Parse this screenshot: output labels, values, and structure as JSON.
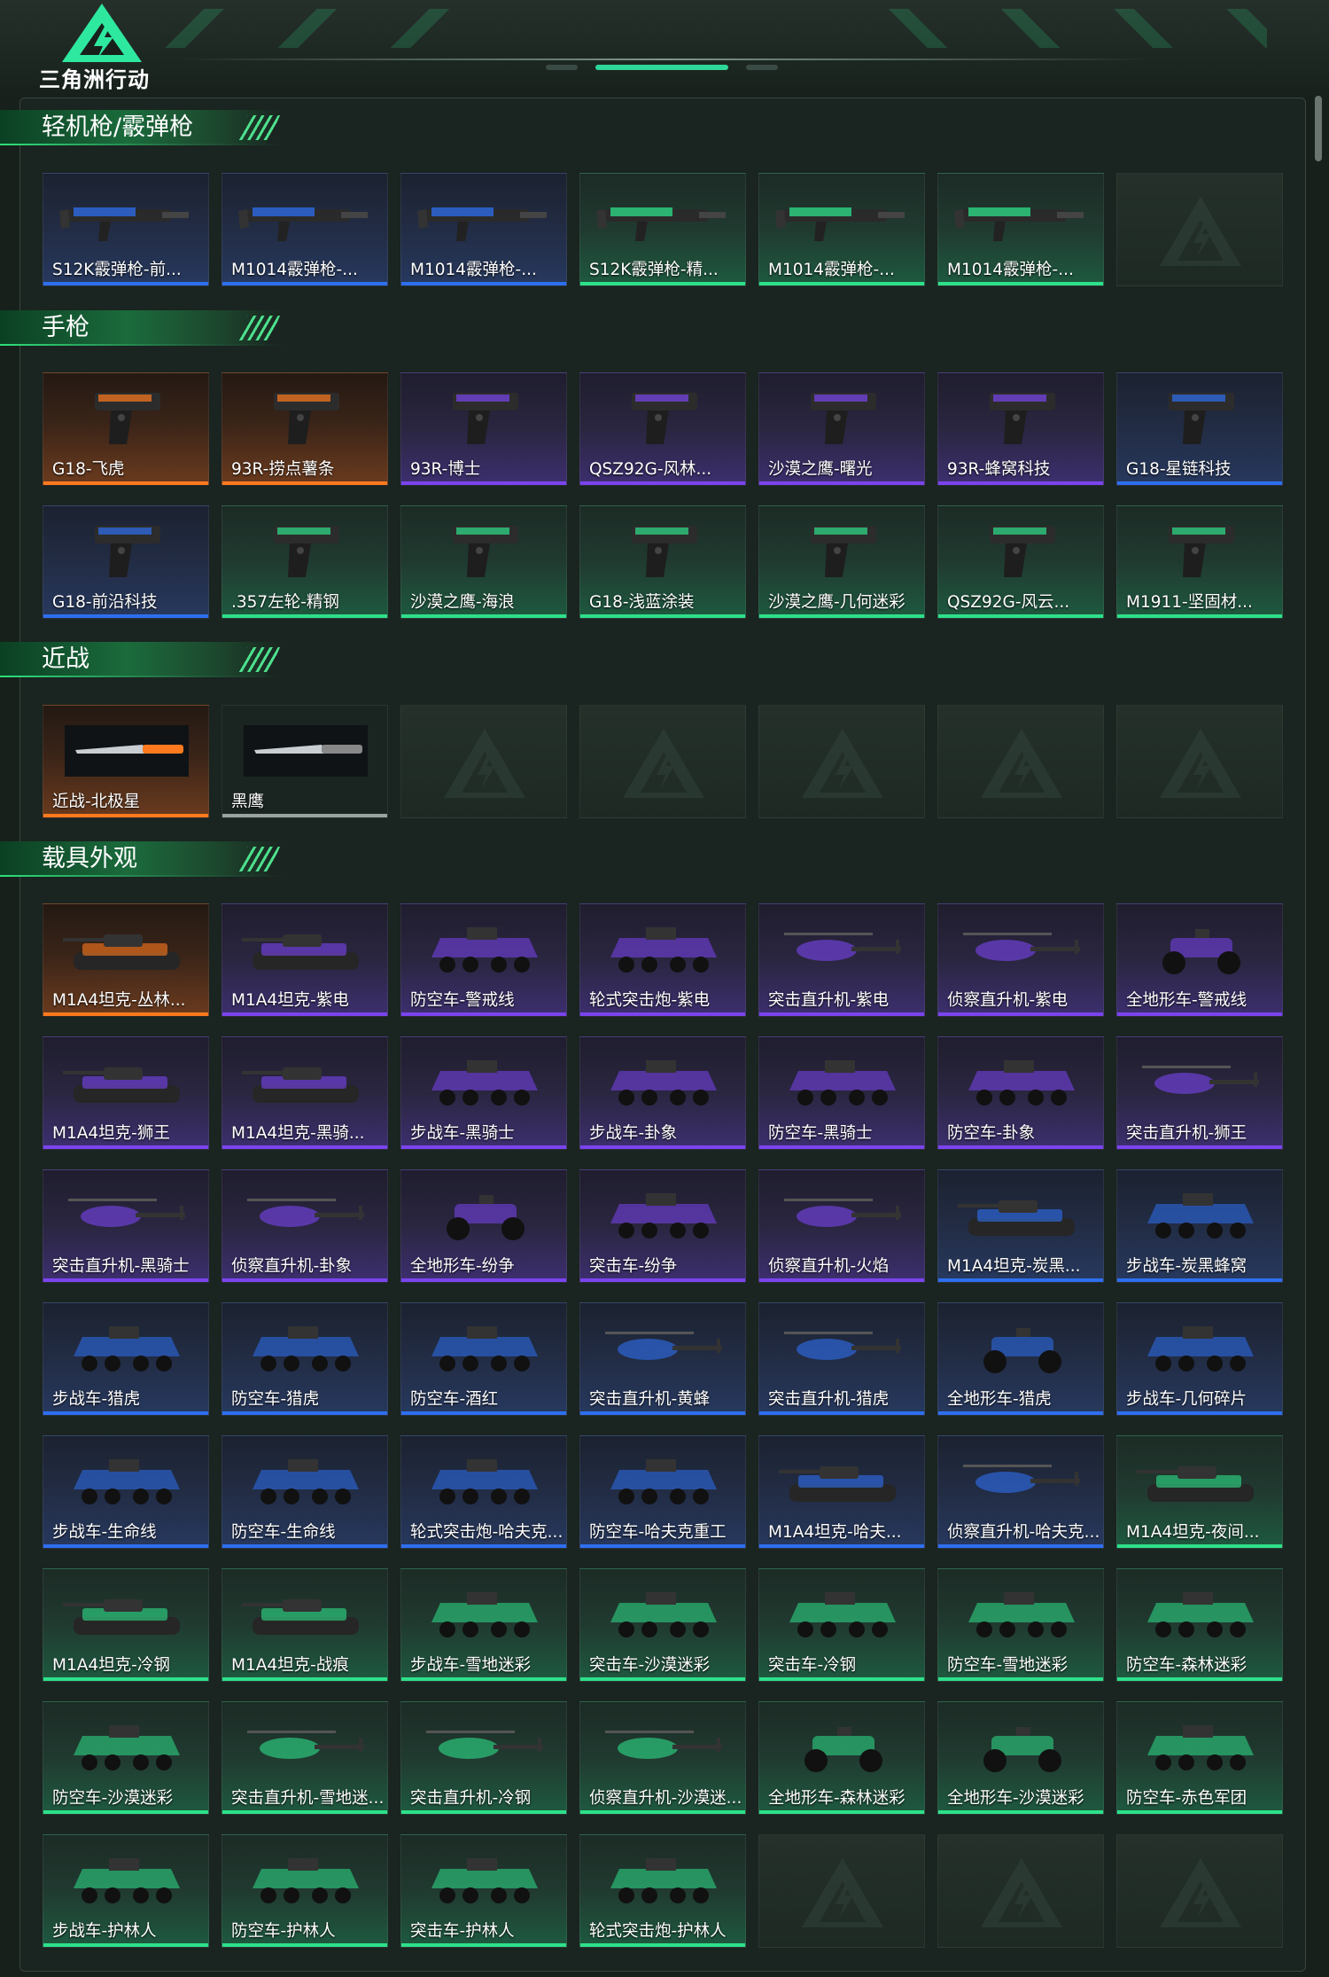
{
  "header": {
    "game_logo_text": "三角洲行动"
  },
  "colors": {
    "orange": "#ff7a1e",
    "purple": "#7a44ee",
    "blue": "#2e6ff0",
    "green": "#2ee08a",
    "accent": "#2ee07a"
  },
  "sections": [
    {
      "title": "轻机枪/霰弹枪",
      "items": [
        {
          "name": "S12K霰弹枪-前...",
          "rarity": "blue",
          "kind": "gun"
        },
        {
          "name": "M1014霰弹枪-...",
          "rarity": "blue",
          "kind": "gun"
        },
        {
          "name": "M1014霰弹枪-...",
          "rarity": "blue",
          "kind": "gun"
        },
        {
          "name": "S12K霰弹枪-精...",
          "rarity": "green",
          "kind": "gun"
        },
        {
          "name": "M1014霰弹枪-...",
          "rarity": "green",
          "kind": "gun"
        },
        {
          "name": "M1014霰弹枪-...",
          "rarity": "green",
          "kind": "gun"
        },
        {
          "empty": true
        }
      ]
    },
    {
      "title": "手枪",
      "items": [
        {
          "name": "G18-飞虎",
          "rarity": "orange",
          "kind": "pistol"
        },
        {
          "name": "93R-捞点薯条",
          "rarity": "orange",
          "kind": "pistol"
        },
        {
          "name": "93R-博士",
          "rarity": "purple",
          "kind": "pistol"
        },
        {
          "name": "QSZ92G-风林...",
          "rarity": "purple",
          "kind": "pistol"
        },
        {
          "name": "沙漠之鹰-曙光",
          "rarity": "purple",
          "kind": "pistol"
        },
        {
          "name": "93R-蜂窝科技",
          "rarity": "purple",
          "kind": "pistol"
        },
        {
          "name": "G18-星链科技",
          "rarity": "blue",
          "kind": "pistol"
        },
        {
          "name": "G18-前沿科技",
          "rarity": "blue",
          "kind": "pistol"
        },
        {
          "name": ".357左轮-精钢",
          "rarity": "green",
          "kind": "pistol"
        },
        {
          "name": "沙漠之鹰-海浪",
          "rarity": "green",
          "kind": "pistol"
        },
        {
          "name": "G18-浅蓝涂装",
          "rarity": "green",
          "kind": "pistol"
        },
        {
          "name": "沙漠之鹰-几何迷彩",
          "rarity": "green",
          "kind": "pistol"
        },
        {
          "name": "QSZ92G-风云...",
          "rarity": "green",
          "kind": "pistol"
        },
        {
          "name": "M1911-坚固材...",
          "rarity": "green",
          "kind": "pistol"
        }
      ]
    },
    {
      "title": "近战",
      "items": [
        {
          "name": "近战-北极星",
          "rarity": "orange",
          "kind": "knife"
        },
        {
          "name": "黑鹰",
          "rarity": "white",
          "kind": "knife"
        },
        {
          "empty": true
        },
        {
          "empty": true
        },
        {
          "empty": true
        },
        {
          "empty": true
        },
        {
          "empty": true
        }
      ]
    },
    {
      "title": "载具外观",
      "items": [
        {
          "name": "M1A4坦克-丛林...",
          "rarity": "orange",
          "kind": "tank"
        },
        {
          "name": "M1A4坦克-紫电",
          "rarity": "purple",
          "kind": "tank"
        },
        {
          "name": "防空车-警戒线",
          "rarity": "purple",
          "kind": "apc"
        },
        {
          "name": "轮式突击炮-紫电",
          "rarity": "purple",
          "kind": "apc"
        },
        {
          "name": "突击直升机-紫电",
          "rarity": "purple",
          "kind": "heli"
        },
        {
          "name": "侦察直升机-紫电",
          "rarity": "purple",
          "kind": "heli"
        },
        {
          "name": "全地形车-警戒线",
          "rarity": "purple",
          "kind": "atv"
        },
        {
          "name": "M1A4坦克-狮王",
          "rarity": "purple",
          "kind": "tank"
        },
        {
          "name": "M1A4坦克-黑骑...",
          "rarity": "purple",
          "kind": "tank"
        },
        {
          "name": "步战车-黑骑士",
          "rarity": "purple",
          "kind": "apc"
        },
        {
          "name": "步战车-卦象",
          "rarity": "purple",
          "kind": "apc"
        },
        {
          "name": "防空车-黑骑士",
          "rarity": "purple",
          "kind": "apc"
        },
        {
          "name": "防空车-卦象",
          "rarity": "purple",
          "kind": "apc"
        },
        {
          "name": "突击直升机-狮王",
          "rarity": "purple",
          "kind": "heli"
        },
        {
          "name": "突击直升机-黑骑士",
          "rarity": "purple",
          "kind": "heli"
        },
        {
          "name": "侦察直升机-卦象",
          "rarity": "purple",
          "kind": "heli"
        },
        {
          "name": "全地形车-纷争",
          "rarity": "purple",
          "kind": "atv"
        },
        {
          "name": "突击车-纷争",
          "rarity": "purple",
          "kind": "apc"
        },
        {
          "name": "侦察直升机-火焰",
          "rarity": "purple",
          "kind": "heli"
        },
        {
          "name": "M1A4坦克-炭黑...",
          "rarity": "blue",
          "kind": "tank"
        },
        {
          "name": "步战车-炭黑蜂窝",
          "rarity": "blue",
          "kind": "apc"
        },
        {
          "name": "步战车-猎虎",
          "rarity": "blue",
          "kind": "apc"
        },
        {
          "name": "防空车-猎虎",
          "rarity": "blue",
          "kind": "apc"
        },
        {
          "name": "防空车-酒红",
          "rarity": "blue",
          "kind": "apc"
        },
        {
          "name": "突击直升机-黄蜂",
          "rarity": "blue",
          "kind": "heli"
        },
        {
          "name": "突击直升机-猎虎",
          "rarity": "blue",
          "kind": "heli"
        },
        {
          "name": "全地形车-猎虎",
          "rarity": "blue",
          "kind": "atv"
        },
        {
          "name": "步战车-几何碎片",
          "rarity": "blue",
          "kind": "apc"
        },
        {
          "name": "步战车-生命线",
          "rarity": "blue",
          "kind": "apc"
        },
        {
          "name": "防空车-生命线",
          "rarity": "blue",
          "kind": "apc"
        },
        {
          "name": "轮式突击炮-哈夫克...",
          "rarity": "blue",
          "kind": "apc"
        },
        {
          "name": "防空车-哈夫克重工",
          "rarity": "blue",
          "kind": "apc"
        },
        {
          "name": "M1A4坦克-哈夫...",
          "rarity": "blue",
          "kind": "tank"
        },
        {
          "name": "侦察直升机-哈夫克...",
          "rarity": "blue",
          "kind": "heli"
        },
        {
          "name": "M1A4坦克-夜间...",
          "rarity": "green",
          "kind": "tank"
        },
        {
          "name": "M1A4坦克-冷钢",
          "rarity": "green",
          "kind": "tank"
        },
        {
          "name": "M1A4坦克-战痕",
          "rarity": "green",
          "kind": "tank"
        },
        {
          "name": "步战车-雪地迷彩",
          "rarity": "green",
          "kind": "apc"
        },
        {
          "name": "突击车-沙漠迷彩",
          "rarity": "green",
          "kind": "apc"
        },
        {
          "name": "突击车-冷钢",
          "rarity": "green",
          "kind": "apc"
        },
        {
          "name": "防空车-雪地迷彩",
          "rarity": "green",
          "kind": "apc"
        },
        {
          "name": "防空车-森林迷彩",
          "rarity": "green",
          "kind": "apc"
        },
        {
          "name": "防空车-沙漠迷彩",
          "rarity": "green",
          "kind": "apc"
        },
        {
          "name": "突击直升机-雪地迷...",
          "rarity": "green",
          "kind": "heli"
        },
        {
          "name": "突击直升机-冷钢",
          "rarity": "green",
          "kind": "heli"
        },
        {
          "name": "侦察直升机-沙漠迷...",
          "rarity": "green",
          "kind": "heli"
        },
        {
          "name": "全地形车-森林迷彩",
          "rarity": "green",
          "kind": "atv"
        },
        {
          "name": "全地形车-沙漠迷彩",
          "rarity": "green",
          "kind": "atv"
        },
        {
          "name": "防空车-赤色军团",
          "rarity": "green",
          "kind": "apc"
        },
        {
          "name": "步战车-护林人",
          "rarity": "green",
          "kind": "apc"
        },
        {
          "name": "防空车-护林人",
          "rarity": "green",
          "kind": "apc"
        },
        {
          "name": "突击车-护林人",
          "rarity": "green",
          "kind": "apc"
        },
        {
          "name": "轮式突击炮-护林人",
          "rarity": "green",
          "kind": "apc"
        },
        {
          "empty": true
        },
        {
          "empty": true
        },
        {
          "empty": true
        }
      ]
    }
  ]
}
